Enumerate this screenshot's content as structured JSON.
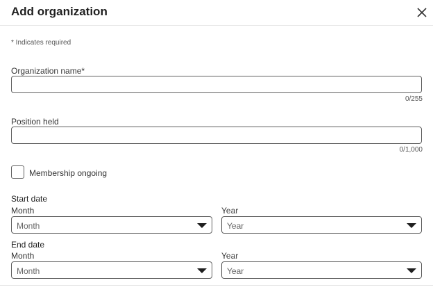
{
  "dialog": {
    "title": "Add organization",
    "required_note": "* Indicates required"
  },
  "organization_name": {
    "label": "Organization name*",
    "value": "",
    "counter": "0/255"
  },
  "position_held": {
    "label": "Position held",
    "value": "",
    "counter": "0/1,000"
  },
  "membership_ongoing": {
    "label": "Membership ongoing",
    "checked": false
  },
  "start_date": {
    "heading": "Start date",
    "month_label": "Month",
    "month_value": "Month",
    "year_label": "Year",
    "year_value": "Year"
  },
  "end_date": {
    "heading": "End date",
    "month_label": "Month",
    "month_value": "Month",
    "year_label": "Year",
    "year_value": "Year"
  },
  "icons": {
    "close": "close-icon",
    "caret": "chevron-down-icon"
  }
}
